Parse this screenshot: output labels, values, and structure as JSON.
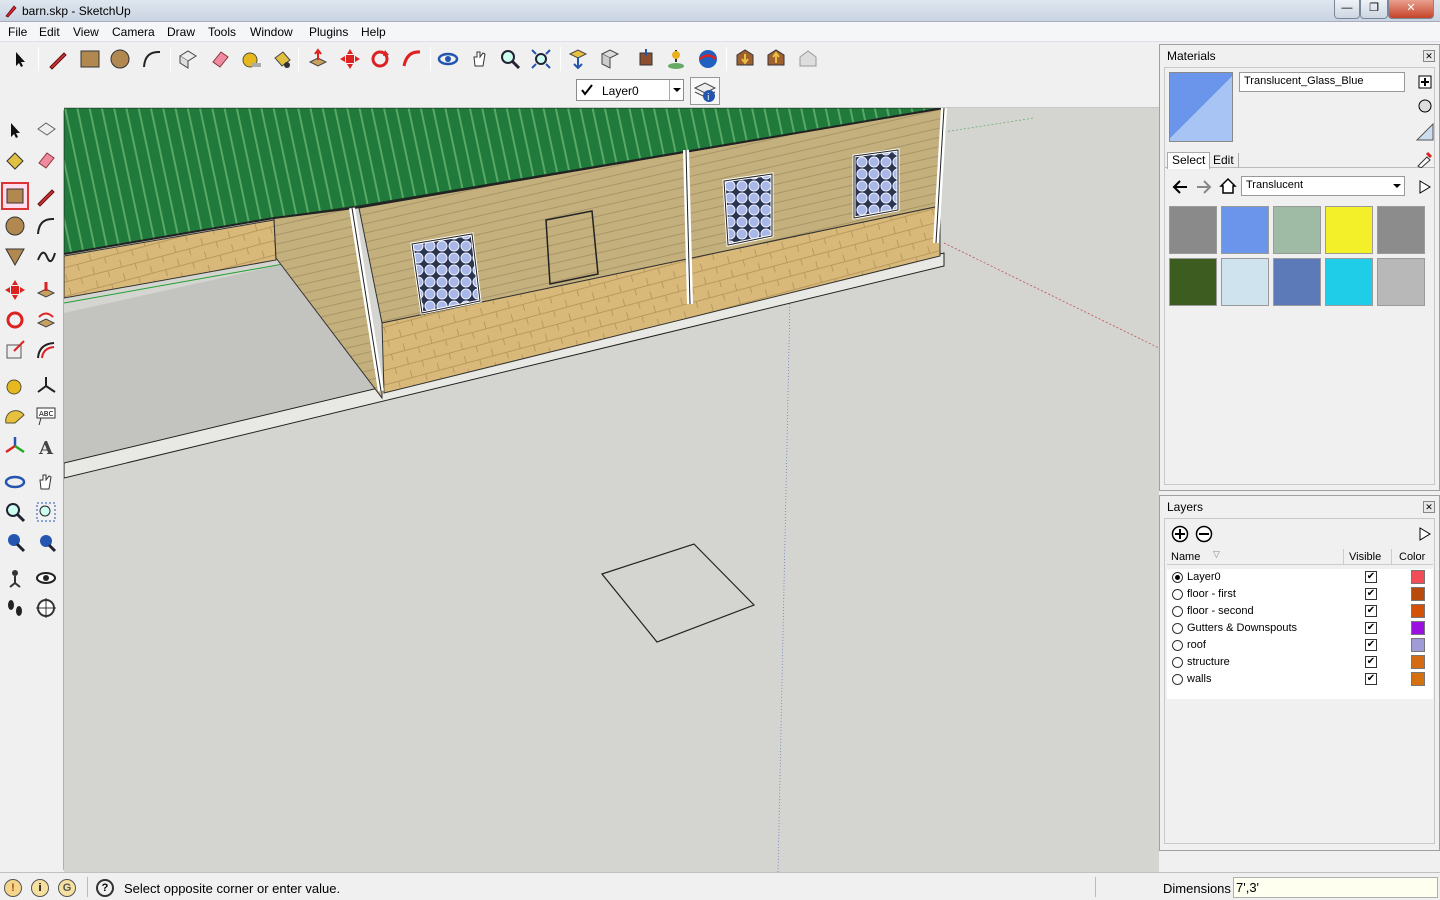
{
  "window": {
    "title": "barn.skp - SketchUp",
    "controls": [
      "—",
      "❐",
      "✕"
    ]
  },
  "menu": [
    "File",
    "Edit",
    "View",
    "Camera",
    "Draw",
    "Tools",
    "Window",
    "Plugins",
    "Help"
  ],
  "layer_toolbar": {
    "current_layer": "Layer0"
  },
  "materials": {
    "title": "Materials",
    "current_name": "Translucent_Glass_Blue",
    "tabs": [
      "Select",
      "Edit"
    ],
    "active_tab": "Select",
    "library": "Translucent",
    "swatch_colors": [
      "#8a8a8a",
      "#6a95ea",
      "#9fbba6",
      "#f3f02a",
      "#8c8c8c",
      "#3d5c20",
      "#cfe3ee",
      "#5c79b8",
      "#1fcde8",
      "#b8b8b8"
    ],
    "current_color": "#6a95ea"
  },
  "layers": {
    "title": "Layers",
    "columns": {
      "name": "Name",
      "visible": "Visible",
      "color": "Color"
    },
    "rows": [
      {
        "name": "Layer0",
        "active": true,
        "visible": true,
        "color": "#f24d57"
      },
      {
        "name": "floor - first",
        "active": false,
        "visible": true,
        "color": "#b84a0e"
      },
      {
        "name": "floor - second",
        "active": false,
        "visible": true,
        "color": "#d4510a"
      },
      {
        "name": "Gutters & Downspouts",
        "active": false,
        "visible": true,
        "color": "#9a10e0"
      },
      {
        "name": "roof",
        "active": false,
        "visible": true,
        "color": "#a09ad6"
      },
      {
        "name": "structure",
        "active": false,
        "visible": true,
        "color": "#d46a14"
      },
      {
        "name": "walls",
        "active": false,
        "visible": true,
        "color": "#d4710e"
      }
    ]
  },
  "status": {
    "message": "Select opposite corner or enter value.",
    "dimensions_label": "Dimensions",
    "dimensions_value": "7',3'"
  }
}
